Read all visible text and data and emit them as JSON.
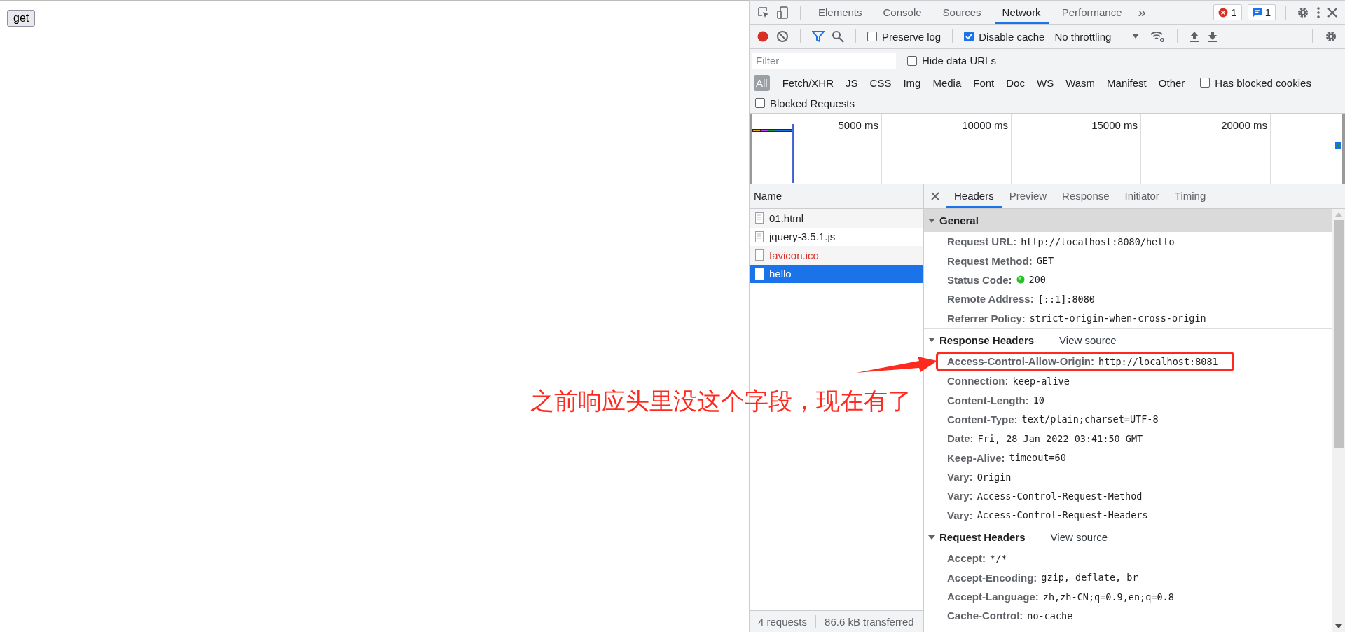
{
  "page": {
    "button": "get"
  },
  "devtools": {
    "tabs": [
      {
        "label": "Elements",
        "selected": false
      },
      {
        "label": "Console",
        "selected": false
      },
      {
        "label": "Sources",
        "selected": false
      },
      {
        "label": "Network",
        "selected": true
      },
      {
        "label": "Performance",
        "selected": false
      }
    ],
    "more_tabs": "»",
    "error_count": "1",
    "message_count": "1",
    "toolbar": {
      "preserve_log": {
        "label": "Preserve log",
        "checked": false
      },
      "disable_cache": {
        "label": "Disable cache",
        "checked": true
      },
      "throttling": "No throttling",
      "recording": true
    },
    "filter": {
      "placeholder": "Filter",
      "hide_data_urls": {
        "label": "Hide data URLs",
        "checked": false
      }
    },
    "types": [
      {
        "label": "All",
        "selected": true
      },
      {
        "label": "Fetch/XHR",
        "selected": false
      },
      {
        "label": "JS",
        "selected": false
      },
      {
        "label": "CSS",
        "selected": false
      },
      {
        "label": "Img",
        "selected": false
      },
      {
        "label": "Media",
        "selected": false
      },
      {
        "label": "Font",
        "selected": false
      },
      {
        "label": "Doc",
        "selected": false
      },
      {
        "label": "WS",
        "selected": false
      },
      {
        "label": "Wasm",
        "selected": false
      },
      {
        "label": "Manifest",
        "selected": false
      },
      {
        "label": "Other",
        "selected": false
      }
    ],
    "has_blocked_cookies": {
      "label": "Has blocked cookies",
      "checked": false
    },
    "blocked_requests": {
      "label": "Blocked Requests",
      "checked": false
    },
    "overview_ticks": [
      "5000 ms",
      "10000 ms",
      "15000 ms",
      "20000 ms"
    ],
    "name_header": "Name",
    "requests": [
      {
        "name": "01.html",
        "selected": false,
        "failed": false
      },
      {
        "name": "jquery-3.5.1.js",
        "selected": false,
        "failed": false
      },
      {
        "name": "favicon.ico",
        "selected": false,
        "failed": true
      },
      {
        "name": "hello",
        "selected": true,
        "failed": false
      }
    ],
    "status_bar": [
      "4 requests",
      "86.6 kB transferred"
    ],
    "detail_tabs": [
      {
        "label": "Headers",
        "selected": true
      },
      {
        "label": "Preview",
        "selected": false
      },
      {
        "label": "Response",
        "selected": false
      },
      {
        "label": "Initiator",
        "selected": false
      },
      {
        "label": "Timing",
        "selected": false
      }
    ],
    "sections": [
      {
        "title": "General",
        "expanded": true,
        "shaded": true,
        "rows": [
          {
            "name": "Request URL:",
            "value": "http://localhost:8080/hello",
            "highlighted": false,
            "status_ok": false
          },
          {
            "name": "Request Method:",
            "value": "GET",
            "highlighted": false,
            "status_ok": false
          },
          {
            "name": "Status Code:",
            "value": "200",
            "highlighted": false,
            "status_ok": true
          },
          {
            "name": "Remote Address:",
            "value": "[::1]:8080",
            "highlighted": false,
            "status_ok": false
          },
          {
            "name": "Referrer Policy:",
            "value": "strict-origin-when-cross-origin",
            "highlighted": false,
            "status_ok": false
          }
        ]
      },
      {
        "title": "Response Headers",
        "view_source": "View source",
        "expanded": true,
        "shaded": false,
        "rows": [
          {
            "name": "Access-Control-Allow-Origin:",
            "value": "http://localhost:8081",
            "highlighted": true,
            "status_ok": false
          },
          {
            "name": "Connection:",
            "value": "keep-alive",
            "highlighted": false,
            "status_ok": false
          },
          {
            "name": "Content-Length:",
            "value": "10",
            "highlighted": false,
            "status_ok": false
          },
          {
            "name": "Content-Type:",
            "value": "text/plain;charset=UTF-8",
            "highlighted": false,
            "status_ok": false
          },
          {
            "name": "Date:",
            "value": "Fri, 28 Jan 2022 03:41:50 GMT",
            "highlighted": false,
            "status_ok": false
          },
          {
            "name": "Keep-Alive:",
            "value": "timeout=60",
            "highlighted": false,
            "status_ok": false
          },
          {
            "name": "Vary:",
            "value": "Origin",
            "highlighted": false,
            "status_ok": false
          },
          {
            "name": "Vary:",
            "value": "Access-Control-Request-Method",
            "highlighted": false,
            "status_ok": false
          },
          {
            "name": "Vary:",
            "value": "Access-Control-Request-Headers",
            "highlighted": false,
            "status_ok": false
          }
        ]
      },
      {
        "title": "Request Headers",
        "view_source": "View source",
        "expanded": true,
        "shaded": false,
        "rows": [
          {
            "name": "Accept:",
            "value": "*/*",
            "highlighted": false,
            "status_ok": false
          },
          {
            "name": "Accept-Encoding:",
            "value": "gzip, deflate, br",
            "highlighted": false,
            "status_ok": false
          },
          {
            "name": "Accept-Language:",
            "value": "zh,zh-CN;q=0.9,en;q=0.8",
            "highlighted": false,
            "status_ok": false
          },
          {
            "name": "Cache-Control:",
            "value": "no-cache",
            "highlighted": false,
            "status_ok": false
          }
        ]
      }
    ]
  },
  "annotation": {
    "text": "之前响应头里没这个字段，现在有了"
  }
}
